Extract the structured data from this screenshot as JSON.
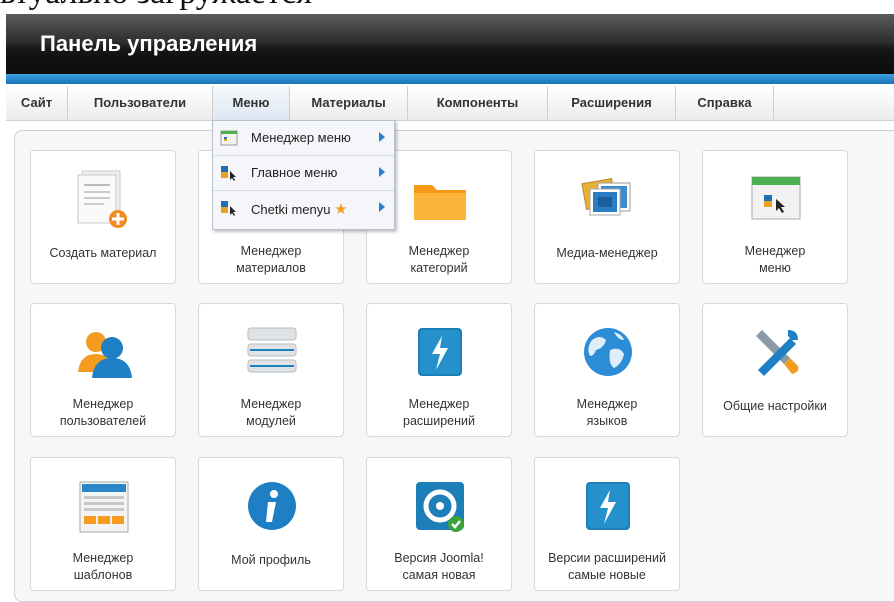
{
  "top_fragment": "ьтуально загружается",
  "header": {
    "title": "Панель управления"
  },
  "menu": {
    "items": [
      "Сайт",
      "Пользователи",
      "Меню",
      "Материалы",
      "Компоненты",
      "Расширения",
      "Справка"
    ],
    "active": "Меню",
    "dropdown": [
      {
        "label": "Менеджер меню",
        "icon": "menu-manager-icon"
      },
      {
        "label": "Главное меню",
        "icon": "menu-icon"
      },
      {
        "label": "Chetki menyu",
        "icon": "menu-icon",
        "star": true
      }
    ]
  },
  "tiles": [
    {
      "label": "Создать материал",
      "icon": "add-article-icon"
    },
    {
      "label": "Менеджер материалов",
      "icon": "article-manager-icon"
    },
    {
      "label": "Менеджер категорий",
      "icon": "folder-icon"
    },
    {
      "label": "Медиа-менеджер",
      "icon": "media-icon"
    },
    {
      "label": "Менеджер меню",
      "icon": "menu-manager-icon"
    },
    {
      "label": "Менеджер пользователей",
      "icon": "users-icon"
    },
    {
      "label": "Менеджер модулей",
      "icon": "modules-icon"
    },
    {
      "label": "Менеджер расширений",
      "icon": "extensions-icon"
    },
    {
      "label": "Менеджер языков",
      "icon": "globe-icon"
    },
    {
      "label": "Общие настройки",
      "icon": "tools-icon"
    },
    {
      "label": "Менеджер шаблонов",
      "icon": "templates-icon"
    },
    {
      "label": "Мой профиль",
      "icon": "info-icon"
    },
    {
      "label": "Версия Joomla! самая новая",
      "icon": "joomla-icon"
    },
    {
      "label": "Версии расширений самые новые",
      "icon": "extensions-update-icon"
    }
  ],
  "tile_labels_split": {
    "t1": [
      "Менеджер",
      "материалов"
    ],
    "t2": [
      "Менеджер",
      "категорий"
    ],
    "t4": [
      "Менеджер",
      "меню"
    ],
    "t5": [
      "Менеджер",
      "пользователей"
    ],
    "t6": [
      "Менеджер",
      "модулей"
    ],
    "t7": [
      "Менеджер",
      "расширений"
    ],
    "t8": [
      "Менеджер",
      "языков"
    ],
    "t10": [
      "Менеджер",
      "шаблонов"
    ],
    "t12": [
      "Версия Joomla!",
      "самая новая"
    ],
    "t13": [
      "Версии расширений",
      "самые новые"
    ]
  },
  "colors": {
    "accent": "#1a74b8",
    "folder": "#f7a21b",
    "blue_icon": "#1d7fb8"
  }
}
